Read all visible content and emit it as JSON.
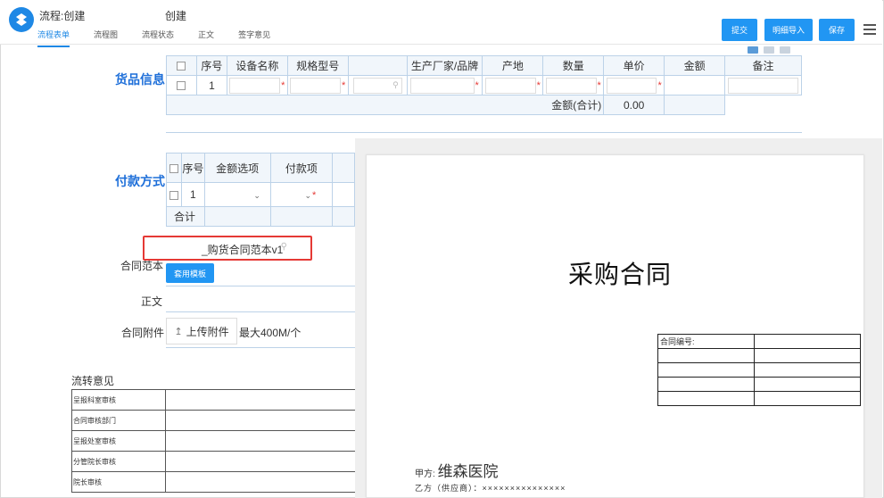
{
  "header": {
    "title": "流程:创建",
    "title2": "创建",
    "tabs": [
      {
        "label": "流程表单",
        "active": true
      },
      {
        "label": "流程图",
        "active": false
      },
      {
        "label": "流程状态",
        "active": false
      },
      {
        "label": "正文",
        "active": false
      },
      {
        "label": "签字意见",
        "active": false
      }
    ],
    "buttons": {
      "submit": "提交",
      "import": "明细导入",
      "save": "保存"
    },
    "accent_color": "#2196f3"
  },
  "goods": {
    "section_label": "货品信息",
    "columns": [
      "序号",
      "设备名称",
      "规格型号",
      "",
      "生产厂家/品牌",
      "产地",
      "数量",
      "单价",
      "金额",
      "备注"
    ],
    "row_index": "1",
    "total_label": "金额(合计)",
    "total_value": "0.00"
  },
  "payment": {
    "section_label": "付款方式",
    "columns": [
      "序号",
      "金额选项",
      "付款项"
    ],
    "row_index": "1",
    "total_label": "合计"
  },
  "contract": {
    "template_label": "合同范本",
    "template_value": "_购货合同范本v1",
    "use_template_button": "套用模板",
    "body_label": "正文",
    "attachment_label": "合同附件",
    "upload_button": "上传附件",
    "upload_hint": "最大400M/个"
  },
  "flow": {
    "title": "流转意见",
    "rows": [
      "呈报科室审核",
      "合同审核部门",
      "呈报处室审核",
      "分管院长审核",
      "院长审核"
    ]
  },
  "preview": {
    "doc_title": "采购合同",
    "meta_first_label": "合同编号:",
    "party_a_prefix": "甲方:",
    "party_a_name": "维森医院",
    "party_b": "乙方（供应商）：×××××××××××××××"
  }
}
